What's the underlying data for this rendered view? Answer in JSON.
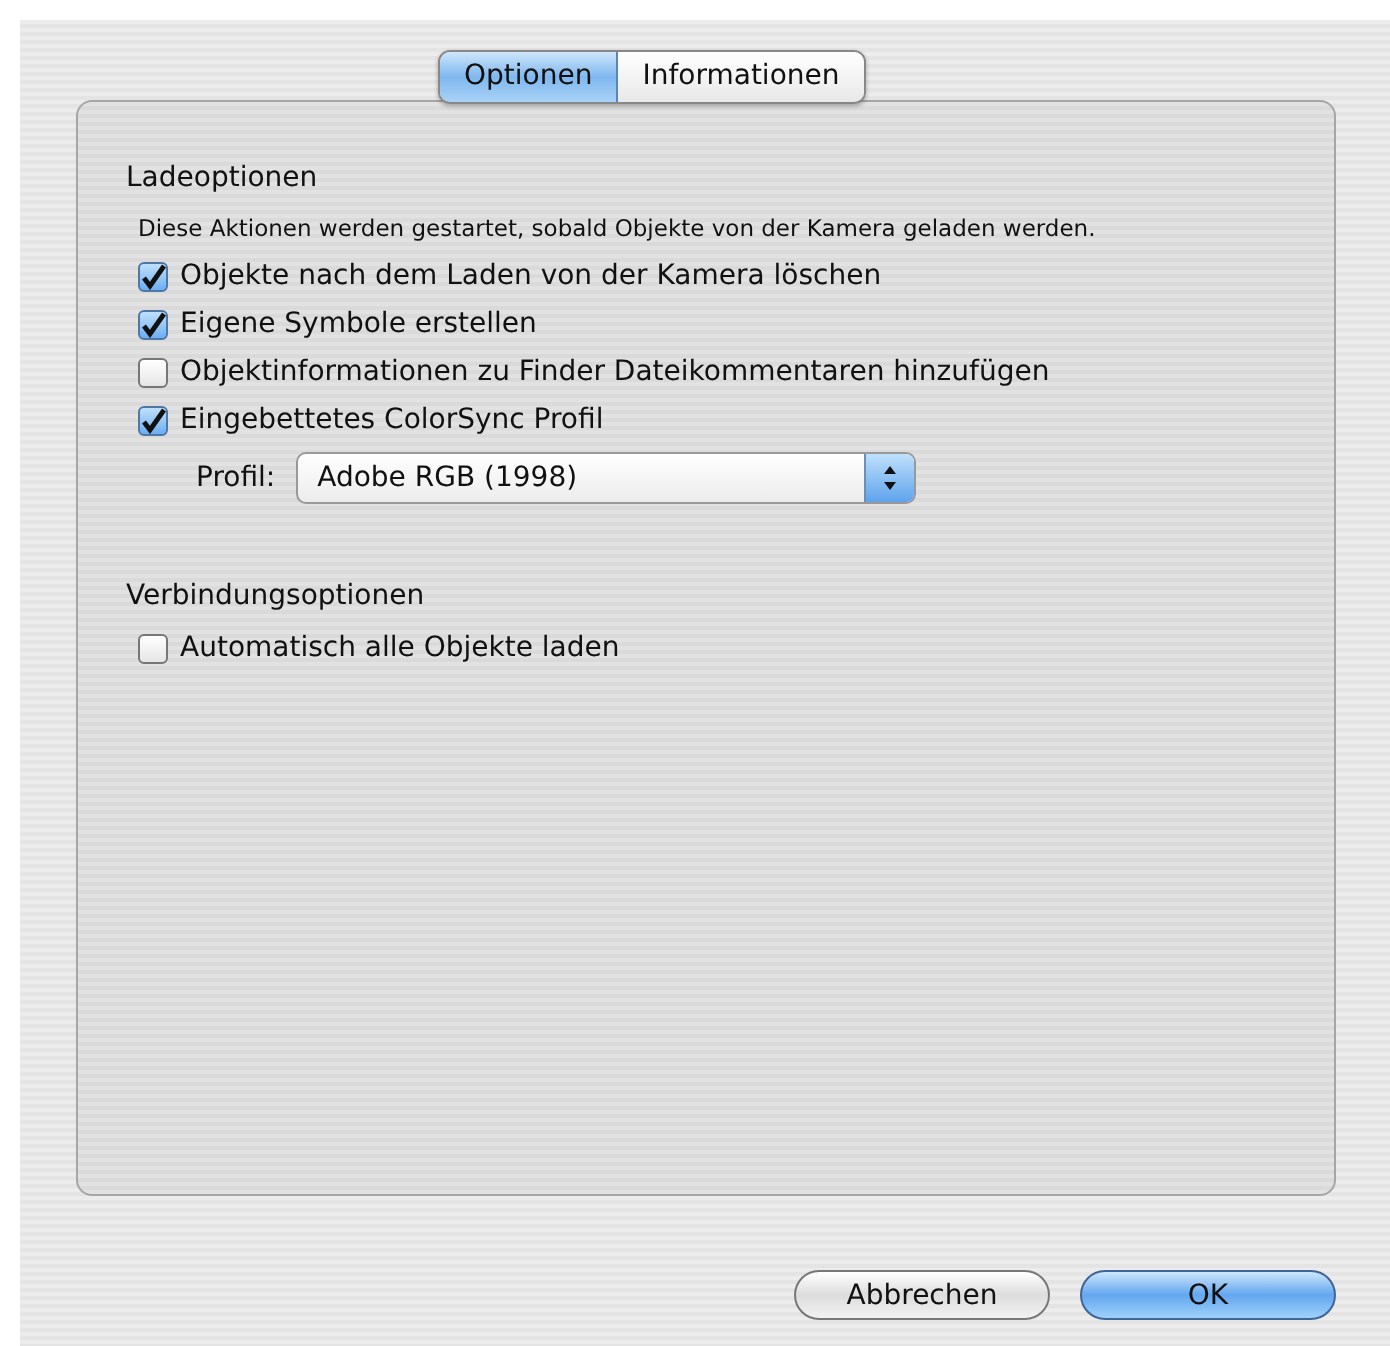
{
  "tabs": [
    {
      "label": "Optionen",
      "selected": true
    },
    {
      "label": "Informationen",
      "selected": false
    }
  ],
  "load_options": {
    "heading": "Ladeoptionen",
    "description": "Diese Aktionen werden gestartet, sobald Objekte von der Kamera geladen werden.",
    "checkboxes": [
      {
        "label": "Objekte nach dem Laden von der Kamera löschen",
        "checked": true
      },
      {
        "label": "Eigene Symbole erstellen",
        "checked": true
      },
      {
        "label": "Objektinformationen zu Finder Dateikommentaren hinzufügen",
        "checked": false
      },
      {
        "label": "Eingebettetes ColorSync Profil",
        "checked": true
      }
    ],
    "profile": {
      "label": "Profil:",
      "value": "Adobe RGB (1998)"
    }
  },
  "connection_options": {
    "heading": "Verbindungsoptionen",
    "checkboxes": [
      {
        "label": "Automatisch alle Objekte laden",
        "checked": false
      }
    ]
  },
  "buttons": [
    {
      "label": "Abbrechen",
      "default": false
    },
    {
      "label": "OK",
      "default": true
    }
  ]
}
